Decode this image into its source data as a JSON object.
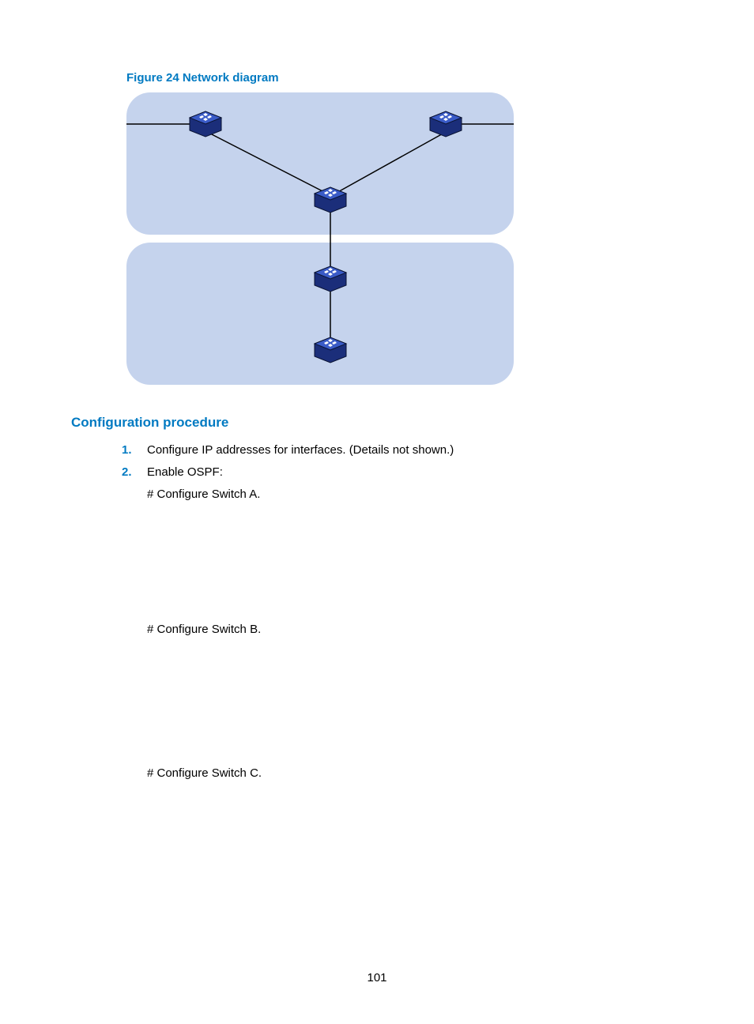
{
  "figure": {
    "caption": "Figure 24 Network diagram"
  },
  "section": {
    "heading": "Configuration procedure"
  },
  "steps": [
    {
      "num": "1.",
      "text": "Configure IP addresses for interfaces. (Details not shown.)"
    },
    {
      "num": "2.",
      "text": "Enable OSPF:"
    }
  ],
  "substeps": {
    "a": "# Configure Switch A.",
    "b": "# Configure Switch B.",
    "c": "# Configure Switch C."
  },
  "pagenum": "101"
}
